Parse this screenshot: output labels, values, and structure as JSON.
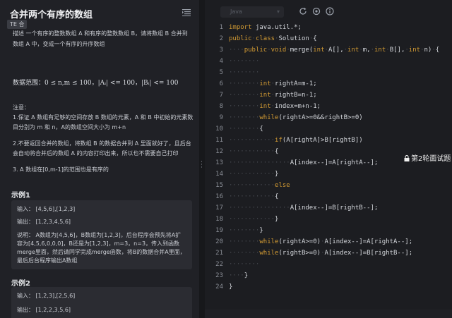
{
  "problem": {
    "title": "合并两个有序的数组",
    "tag": "TE 合",
    "description": "描述  一个有序的整数数组 A 和有序的整数数组 B，请将数组 B 合并到数组 A 中，变成一个有序的升序数组",
    "range": "数据范围：0 ≤ n,m ≤ 100，|Aᵢ| <= 100，|Bᵢ| <= 100",
    "notes_header": "注意：",
    "notes": [
      "1.保证 A 数组有足够的空间存放 B 数组的元素，A 和 B 中初始的元素数目分别为 m 和 n，A的数组空间大小为 m+n",
      "2.不要返回合并的数组，将数组 B 的数据合并到 A 里面就好了，且后台会自动将合并后的数组 A 的内容打印出来，所以也不需要自己打印",
      "3. A 数组在[0,m-1]的范围也是有序的"
    ],
    "examples": [
      {
        "title": "示例1",
        "input": "输入：  [4,5,6],[1,2,3]",
        "output": "输出：  [1,2,3,4,5,6]",
        "explanation": "说明：  A数组为[4,5,6]，B数组为[1,2,3]，后台程序会预先将A扩容为[4,5,6,0,0,0]，B还是为[1,2,3]，m=3，n=3，传入到函数merge里面，然后请同学完成merge函数，将B的数据合并A里面，最后后台程序输出A数组"
      },
      {
        "title": "示例2",
        "input": "输入：  [1,2,3],[2,5,6]",
        "output": "输出：  [1,2,2,3,5,6]"
      }
    ]
  },
  "editor": {
    "language": "Java",
    "toolbar_icons": [
      "refresh-icon",
      "settings-icon",
      "info-icon"
    ],
    "line_numbers": [
      "1",
      "2",
      "3",
      "4",
      "5",
      "6",
      "7",
      "8",
      "9",
      "10",
      "11",
      "12",
      "13",
      "14",
      "15",
      "16",
      "17",
      "18",
      "19",
      "20",
      "21",
      "22",
      "23",
      "24"
    ]
  },
  "overlay": {
    "label": "第2轮面试题"
  },
  "colors": {
    "keyword": "#d19a33",
    "background": "#1c1d21",
    "panel": "#202126"
  }
}
